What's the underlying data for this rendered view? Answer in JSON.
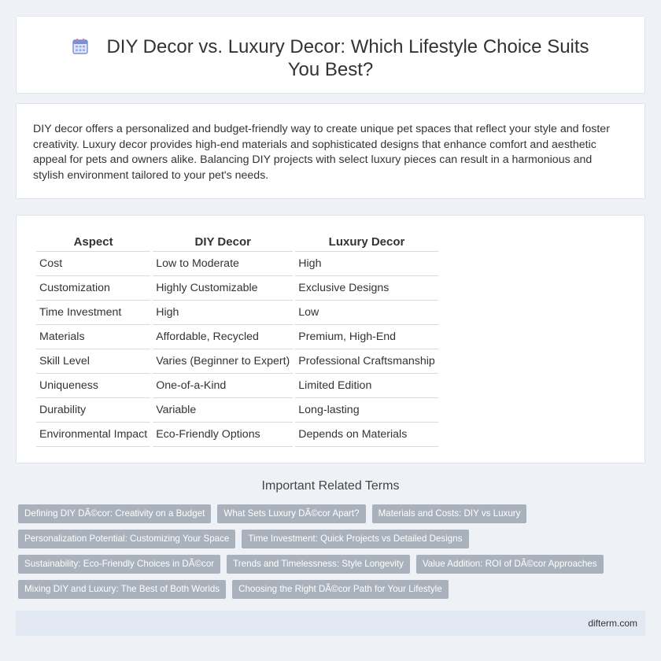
{
  "header": {
    "title": "DIY Decor vs. Luxury Decor: Which Lifestyle Choice Suits You Best?",
    "icon": "calendar-icon",
    "accent": "#7b8fd6"
  },
  "intro": {
    "text": "DIY decor offers a personalized and budget-friendly way to create unique pet spaces that reflect your style and foster creativity. Luxury decor provides high-end materials and sophisticated designs that enhance comfort and aesthetic appeal for pets and owners alike. Balancing DIY projects with select luxury pieces can result in a harmonious and stylish environment tailored to your pet's needs."
  },
  "comparison": {
    "headers": [
      "Aspect",
      "DIY Decor",
      "Luxury Decor"
    ],
    "rows": [
      [
        "Cost",
        "Low to Moderate",
        "High"
      ],
      [
        "Customization",
        "Highly Customizable",
        "Exclusive Designs"
      ],
      [
        "Time Investment",
        "High",
        "Low"
      ],
      [
        "Materials",
        "Affordable, Recycled",
        "Premium, High-End"
      ],
      [
        "Skill Level",
        "Varies (Beginner to Expert)",
        "Professional Craftsmanship"
      ],
      [
        "Uniqueness",
        "One-of-a-Kind",
        "Limited Edition"
      ],
      [
        "Durability",
        "Variable",
        "Long-lasting"
      ],
      [
        "Environmental Impact",
        "Eco-Friendly Options",
        "Depends on Materials"
      ]
    ]
  },
  "related": {
    "title": "Important Related Terms",
    "tags": [
      "Defining DIY DÃ©cor: Creativity on a Budget",
      "What Sets Luxury DÃ©cor Apart?",
      "Materials and Costs: DIY vs Luxury",
      "Personalization Potential: Customizing Your Space",
      "Time Investment: Quick Projects vs Detailed Designs",
      "Sustainability: Eco-Friendly Choices in DÃ©cor",
      "Trends and Timelessness: Style Longevity",
      "Value Addition: ROI of DÃ©cor Approaches",
      "Mixing DIY and Luxury: The Best of Both Worlds",
      "Choosing the Right DÃ©cor Path for Your Lifestyle"
    ]
  },
  "footer": {
    "site": "difterm.com"
  }
}
